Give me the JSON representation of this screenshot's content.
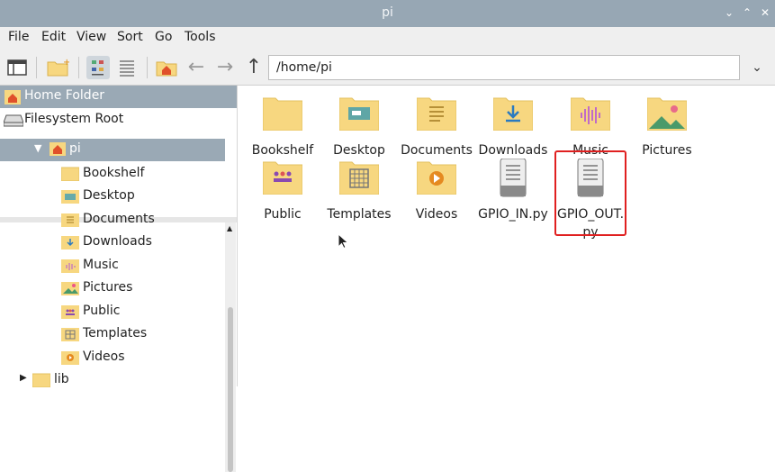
{
  "window": {
    "title": "pi"
  },
  "menu": [
    "File",
    "Edit",
    "View",
    "Sort",
    "Go",
    "Tools"
  ],
  "toolbar": {
    "path": "/home/pi"
  },
  "places": [
    {
      "label": "Home Folder",
      "icon": "home-folder-icon",
      "selected": true
    },
    {
      "label": "Filesystem Root",
      "icon": "drive-icon",
      "selected": false
    }
  ],
  "tree": {
    "root": "pi",
    "children": [
      "Bookshelf",
      "Desktop",
      "Documents",
      "Downloads",
      "Music",
      "Pictures",
      "Public",
      "Templates",
      "Videos"
    ],
    "next": "lib"
  },
  "files": [
    {
      "name": "Bookshelf",
      "icon": "folder-icon"
    },
    {
      "name": "Desktop",
      "icon": "desktop-folder-icon"
    },
    {
      "name": "Documents",
      "icon": "documents-folder-icon"
    },
    {
      "name": "Downloads",
      "icon": "downloads-folder-icon"
    },
    {
      "name": "Music",
      "icon": "music-folder-icon"
    },
    {
      "name": "Pictures",
      "icon": "pictures-folder-icon"
    },
    {
      "name": "Public",
      "icon": "public-folder-icon"
    },
    {
      "name": "Templates",
      "icon": "templates-folder-icon"
    },
    {
      "name": "Videos",
      "icon": "videos-folder-icon"
    },
    {
      "name": "GPIO_IN.py",
      "icon": "python-file-icon"
    },
    {
      "name_line1": "GPIO_OUT.",
      "name_line2": "py",
      "icon": "python-file-icon"
    }
  ],
  "colors": {
    "titlebar": "#97a7b4",
    "folder": "#f7d780",
    "selection": "#9aa9b5",
    "highlight": "#e02020"
  }
}
